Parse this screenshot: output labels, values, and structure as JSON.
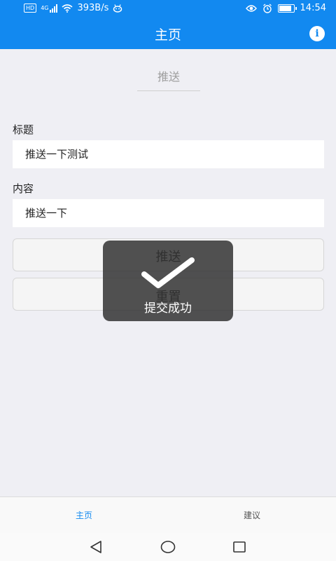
{
  "status_bar": {
    "hd": "HD",
    "network": "4G",
    "speed": "393B/s",
    "time": "14:54",
    "battery_level": 0.95
  },
  "header": {
    "title": "主页",
    "info_icon_glyph": "i"
  },
  "segment": {
    "label": "推送"
  },
  "form": {
    "title_label": "标题",
    "title_value": "推送一下测试",
    "content_label": "内容",
    "content_value": "推送一下"
  },
  "buttons": {
    "push_label": "推送",
    "reset_label": "重置"
  },
  "toast": {
    "message": "提交成功",
    "icon": "check-icon"
  },
  "tabs": [
    {
      "label": "主页",
      "active": true
    },
    {
      "label": "建议",
      "active": false
    }
  ],
  "colors": {
    "primary": "#1289f0",
    "background": "#efeff4",
    "toast_bg": "#323232"
  }
}
